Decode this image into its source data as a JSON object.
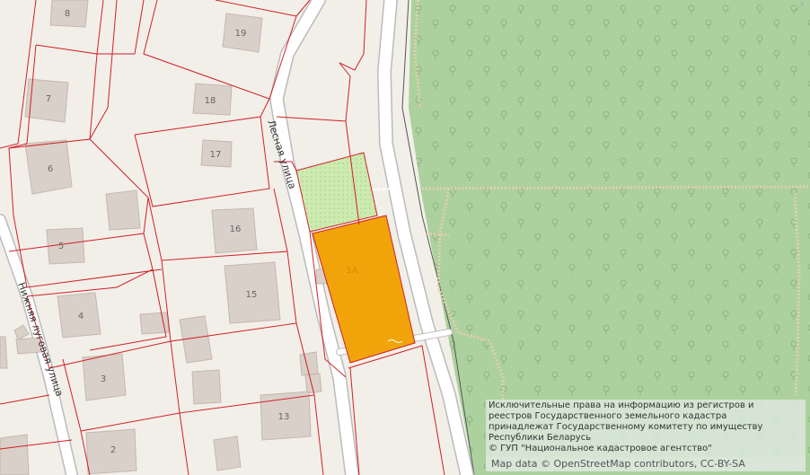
{
  "map": {
    "expand_icon": "expand-icon",
    "colors": {
      "background": "#f2efe9",
      "forest": "#add19e",
      "road": "#ffffff",
      "road_casing": "#bbbbbb",
      "parcel_border": "#d21f26",
      "building": "#d9d0c9",
      "selected_parcel": "#f0a40a",
      "adjacent_parcel": "#cdebb0",
      "path": "#e0c8a8"
    },
    "streets": {
      "lesnaya": "Лесная улица",
      "nizhnyaya": "Нижняя луговая улица"
    },
    "houses": [
      "8",
      "19",
      "7",
      "18",
      "17",
      "6",
      "16",
      "5",
      "15",
      "4",
      "3",
      "13",
      "2"
    ],
    "selected_parcel_label": "1А",
    "attribution": [
      "Исключительные права на информацию из регистров и",
      "реестров Государственного земельного кадастра",
      "принадлежат Государственному комитету по имуществу",
      "Республики Беларусь",
      "© ГУП \"Национальное кадастровое агентство\""
    ],
    "osm_credit": "Map data © OpenStreetMap contributors, CC-BY-SA"
  }
}
